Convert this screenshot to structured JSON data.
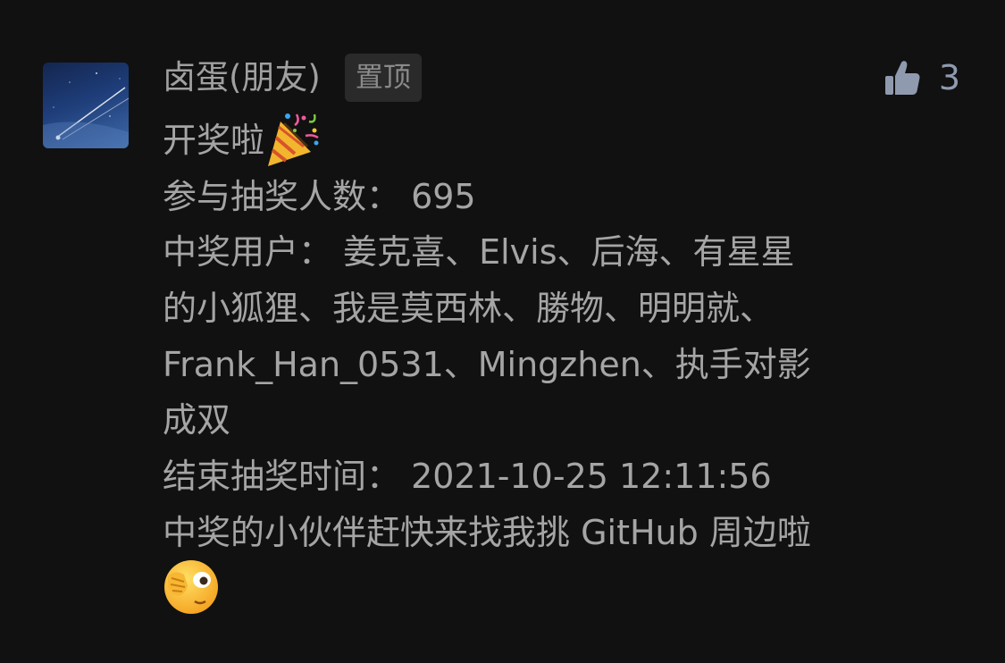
{
  "comment": {
    "author": "卤蛋(朋友)",
    "pin_label": "置顶",
    "like_count": "3",
    "lines": [
      "开奖啦",
      "参与抽奖人数： 695",
      "中奖用户： 姜克喜、Elvis、后海、有星星",
      "的小狐狸、我是莫西林、勝物、明明就、",
      "Frank_Han_0531、Mingzhen、执手对影",
      "成双",
      "结束抽奖时间： 2021-10-25 12:11:56",
      "中奖的小伙伴赶快来找我挑 GitHub 周边啦"
    ],
    "emojis": {
      "party": "party-popper",
      "peek": "face-peeking"
    }
  },
  "colors": {
    "background": "#111111",
    "text": "#a5a5a5",
    "like": "#8f9aaf",
    "badge_bg": "#2a2a2a"
  }
}
